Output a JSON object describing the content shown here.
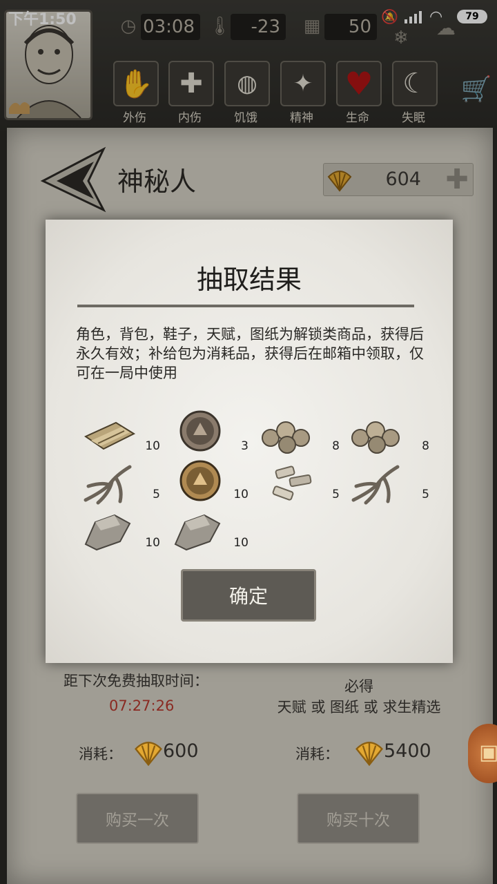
{
  "status_bar": {
    "time": "下午1:50",
    "battery": "79"
  },
  "hud": {
    "clock": "03:08",
    "temperature": "-23",
    "day": "50",
    "status_tiles": [
      {
        "label": "外伤",
        "icon": "bandaged-hand-icon"
      },
      {
        "label": "内伤",
        "icon": "medical-cross-icon"
      },
      {
        "label": "饥饿",
        "icon": "stomach-icon"
      },
      {
        "label": "精神",
        "icon": "head-sparkle-icon"
      },
      {
        "label": "生命",
        "icon": "heart-icon"
      },
      {
        "label": "失眠",
        "icon": "moon-star-icon"
      }
    ]
  },
  "page": {
    "title": "神秘人",
    "coins": "604"
  },
  "modal": {
    "title": "抽取结果",
    "description": "角色，背包，鞋子，天赋，图纸为解锁类商品，获得后永久有效；补给包为消耗品，获得后在邮箱中领取，仅可在一局中使用",
    "items": [
      {
        "icon": "paper-bundle-icon",
        "qty": "10"
      },
      {
        "icon": "bronze-medal-icon",
        "qty": "3"
      },
      {
        "icon": "ore-nuggets-icon",
        "qty": "8"
      },
      {
        "icon": "ore-nuggets-icon",
        "qty": "8"
      },
      {
        "icon": "ginseng-root-icon",
        "qty": "5"
      },
      {
        "icon": "gold-medal-icon",
        "qty": "10"
      },
      {
        "icon": "bandage-scraps-icon",
        "qty": "5"
      },
      {
        "icon": "ginseng-root-icon",
        "qty": "5"
      },
      {
        "icon": "stone-icon",
        "qty": "10"
      },
      {
        "icon": "stone-icon",
        "qty": "10"
      }
    ],
    "confirm_label": "确定"
  },
  "free_draw": {
    "label": "距下次免费抽取时间：",
    "countdown": "07:27:26"
  },
  "guarantee": {
    "line1": "必得",
    "line2": "天赋 或 图纸 或 求生精选"
  },
  "costs": {
    "label": "消耗：",
    "single": "600",
    "ten": "5400"
  },
  "buttons": {
    "buy_once": "购买一次",
    "buy_ten": "购买十次"
  },
  "colors": {
    "timer": "#8a2a22",
    "shell": "#e3a832"
  }
}
